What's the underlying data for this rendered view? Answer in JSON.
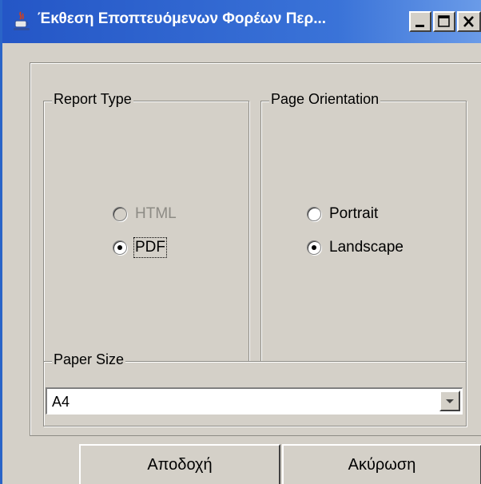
{
  "window": {
    "title": "Έκθεση Εποπτευόμενων Φορέων Περ...",
    "icon": "java-cup-icon",
    "controls": [
      "minimize-icon",
      "maximize-icon",
      "close-icon"
    ]
  },
  "report_type": {
    "legend": "Report Type",
    "options": [
      {
        "label": "HTML",
        "selected": false,
        "enabled": false
      },
      {
        "label": "PDF",
        "selected": true,
        "enabled": true
      }
    ]
  },
  "page_orientation": {
    "legend": "Page Orientation",
    "options": [
      {
        "label": "Portrait",
        "selected": false,
        "enabled": true
      },
      {
        "label": "Landscape",
        "selected": true,
        "enabled": true
      }
    ]
  },
  "paper_size": {
    "legend": "Paper Size",
    "selected": "A4"
  },
  "buttons": {
    "accept": "Αποδοχή",
    "cancel": "Ακύρωση"
  }
}
